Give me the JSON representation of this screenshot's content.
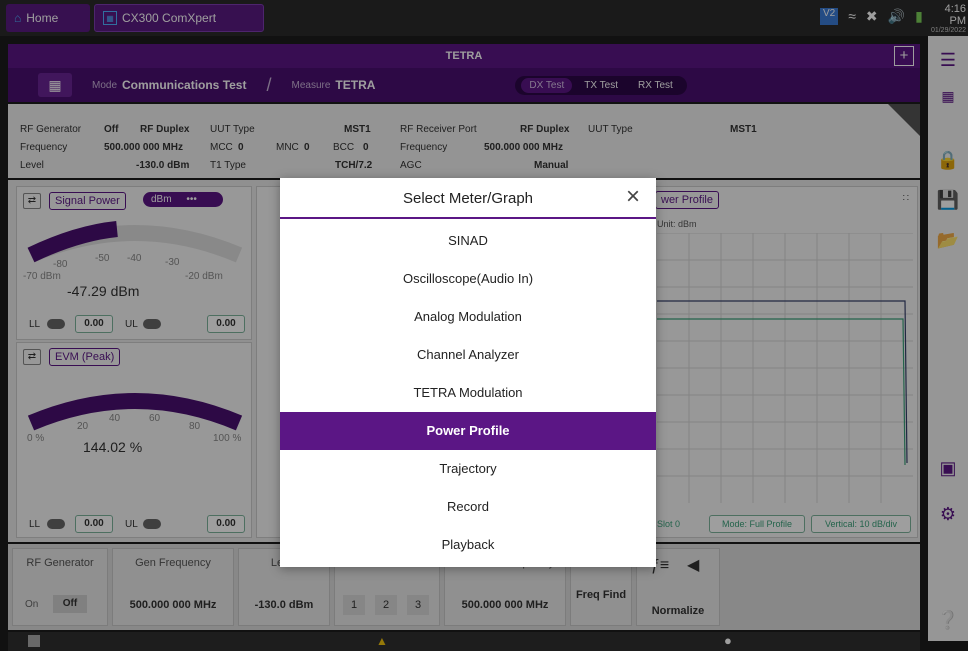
{
  "top": {
    "home_label": "Home",
    "app_label": "CX300 ComXpert",
    "time": "4:16 PM",
    "date": "01/29/2022"
  },
  "title": "TETRA",
  "modebar": {
    "mode_label": "Mode",
    "mode_value": "Communications Test",
    "measure_label": "Measure",
    "measure_value": "TETRA",
    "tests": [
      "DX Test",
      "TX Test",
      "RX Test"
    ]
  },
  "info": {
    "rf_generator_label": "RF Generator",
    "rf_generator_value": "Off",
    "rf_duplex_label": "RF Duplex",
    "frequency_label": "Frequency",
    "frequency_value": "500.000 000 MHz",
    "level_label": "Level",
    "level_value": "-130.0 dBm",
    "uut_type_label": "UUT Type",
    "mcc_label": "MCC",
    "mcc_value": "0",
    "mnc_label": "MNC",
    "mnc_value": "0",
    "t1_type_label": "T1 Type",
    "mst_value": "MST1",
    "bcc_label": "BCC",
    "bcc_value": "0",
    "tch_value": "TCH/7.2",
    "rx_port_label": "RF Receiver Port",
    "rx_port_value": "RF Duplex",
    "rx_freq_label": "Frequency",
    "rx_freq_value": "500.000 000 MHz",
    "agc_label": "AGC",
    "agc_value": "Manual",
    "uut_type2_label": "UUT Type",
    "mst2_value": "MST1"
  },
  "signal_power": {
    "label": "Signal Power",
    "unit": "dBm",
    "more": "•••",
    "ticks": [
      "-80",
      "-50",
      "-40",
      "-30"
    ],
    "min": "-70 dBm",
    "max": "-20 dBm",
    "reading": "-47.29 dBm",
    "ll": "LL",
    "ll_value": "0.00",
    "ul": "UL",
    "ul_value": "0.00"
  },
  "evm": {
    "label": "EVM (Peak)",
    "ticks": [
      "20",
      "40",
      "60",
      "80"
    ],
    "min": "0 %",
    "max": "100 %",
    "reading": "144.02 %",
    "ll": "LL",
    "ll_value": "0.00",
    "ul": "UL",
    "ul_value": "0.00"
  },
  "power_profile": {
    "label": "wer Profile",
    "unit_label": "Unit: dBm",
    "slot": "Slot 0",
    "mode_btn": "Mode: Full Profile",
    "vertical_btn": "Vertical: 10 dB/div"
  },
  "dialog": {
    "title": "Select Meter/Graph",
    "options": [
      "SINAD",
      "Oscilloscope(Audio In)",
      "Analog Modulation",
      "Channel Analyzer",
      "TETRA Modulation",
      "Power Profile",
      "Trajectory",
      "Record",
      "Playback"
    ],
    "selected": "Power Profile"
  },
  "bottom": {
    "rf_gen_title": "RF Generator",
    "rf_on": "On",
    "rf_off": "Off",
    "gen_freq_title": "Gen Frequency",
    "gen_freq_value": "500.000 000 MHz",
    "level_title": "Level",
    "level_value": "-130.0 dBm",
    "mod_gen_title": "Mod Gen",
    "mod_gen_values": [
      "1",
      "2",
      "3"
    ],
    "rx_freq_title": "Receiver Frequency",
    "rx_freq_value": "500.000 000 MHz",
    "freq_find": "Freq Find",
    "normalize": "Normalize"
  }
}
